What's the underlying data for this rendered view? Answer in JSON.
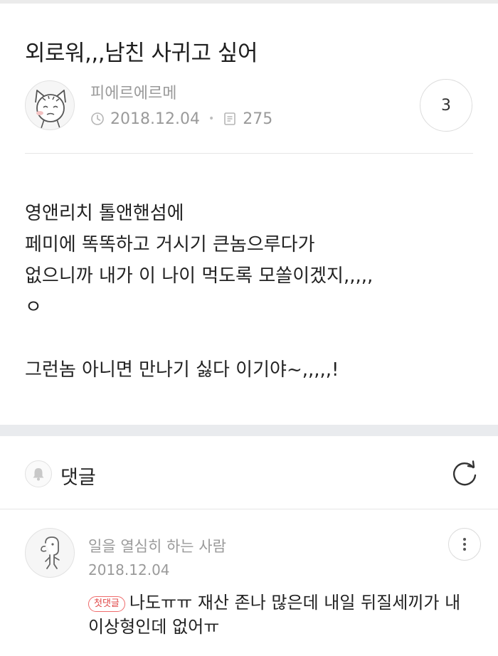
{
  "post": {
    "title": "외로워,,,남친 사귀고 싶어",
    "author": "피에르에르메",
    "date": "2018.12.04",
    "views": "275",
    "comment_count": "3",
    "body": "영앤리치 톨앤핸섬에\n페미에 똑똑하고 거시기 큰놈으루다가\n없으니까 내가 이 나이 먹도록 모쏠이겠지,,,,,\nㅇ\n\n그런놈 아니면 만나기 싫다 이기야~,,,,,!"
  },
  "comments_section": {
    "label": "댓글"
  },
  "comments": [
    {
      "author": "일을 열심히 하는 사람",
      "date": "2018.12.04",
      "badge": "첫댓글",
      "text": "나도ㅠㅠ 재산 존나 많은데 내일 뒤질세끼가 내 이상형인데 없어ㅠ"
    }
  ],
  "icons": {
    "clock": "clock-icon",
    "views": "document-icon",
    "bell": "bell-icon",
    "refresh": "refresh-icon",
    "more": "more-vertical-icon"
  },
  "colors": {
    "badge": "#e04848",
    "meta_text": "#9a9a9a",
    "section_gap": "#e9ebee"
  }
}
